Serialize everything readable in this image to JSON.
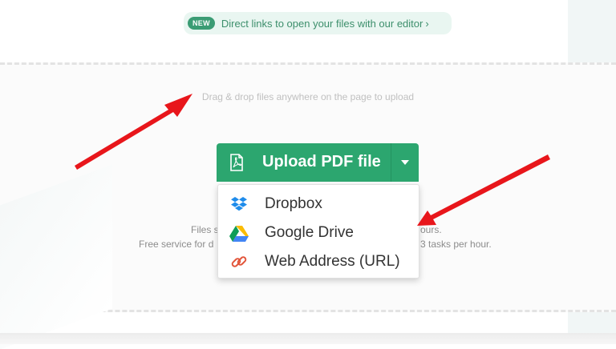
{
  "banner": {
    "badge": "NEW",
    "text": "Direct links to open your files with our editor",
    "chevron": "›"
  },
  "drop_hint": "Drag & drop files anywhere on the page to upload",
  "upload_button": {
    "label": "Upload PDF file",
    "icon": "pdf-file-icon",
    "caret_icon": "caret-down-icon"
  },
  "dropdown": {
    "items": [
      {
        "label": "Dropbox",
        "icon": "dropbox-icon"
      },
      {
        "label": "Google Drive",
        "icon": "google-drive-icon"
      },
      {
        "label": "Web Address (URL)",
        "icon": "link-icon"
      }
    ]
  },
  "info": {
    "line1_left": "Files s",
    "line1_right": "ours.",
    "line2_left": "Free service for d",
    "line2_right": "3 tasks per hour."
  },
  "colors": {
    "accent": "#2ca66f",
    "banner_bg": "#e9f6f1",
    "arrow": "#e8161b"
  }
}
